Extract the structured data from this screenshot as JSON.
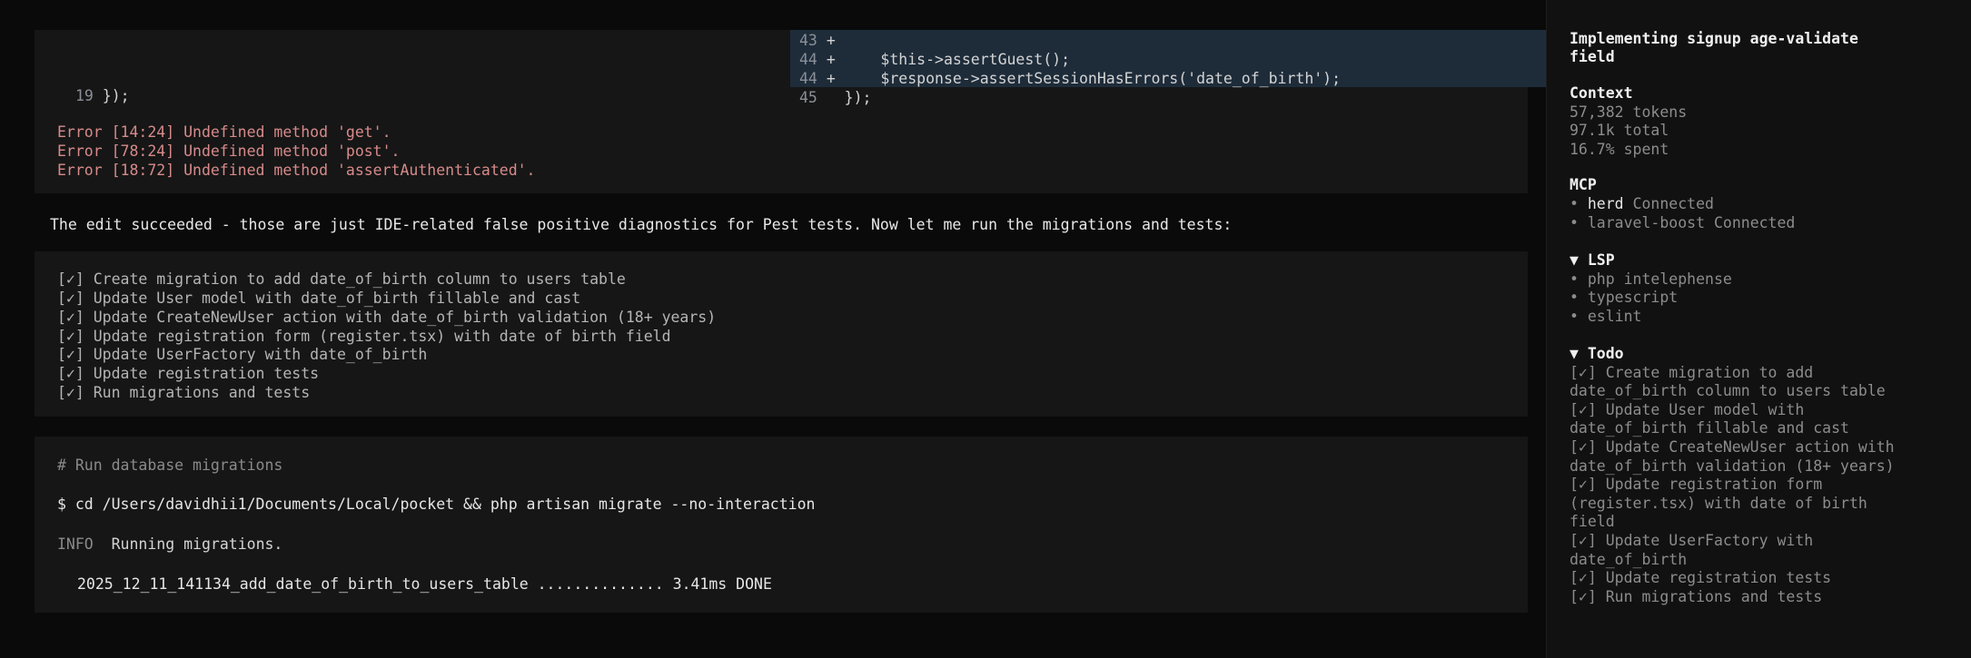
{
  "diff": {
    "lines": [
      {
        "num": "43",
        "mark": "+",
        "code": ""
      },
      {
        "num": "44",
        "mark": "+",
        "code": "    $this->assertGuest();"
      },
      {
        "num": "44",
        "mark": "+",
        "code": "    $response->assertSessionHasErrors('date_of_birth');"
      },
      {
        "num": "45",
        "mark": "",
        "code": " });"
      }
    ]
  },
  "left_code": {
    "num": "19",
    "code": " });"
  },
  "errors": [
    "Error [14:24] Undefined method 'get'.",
    "Error [78:24] Undefined method 'post'.",
    "Error [18:72] Undefined method 'assertAuthenticated'."
  ],
  "message": "The edit succeeded - those are just IDE-related false positive diagnostics for Pest tests. Now let me run the migrations and tests:",
  "todos": [
    "[✓] Create migration to add date_of_birth column to users table",
    "[✓] Update User model with date_of_birth fillable and cast",
    "[✓] Update CreateNewUser action with date_of_birth validation (18+ years)",
    "[✓] Update registration form (register.tsx) with date of birth field",
    "[✓] Update UserFactory with date_of_birth",
    "[✓] Update registration tests",
    "[✓] Run migrations and tests"
  ],
  "terminal": {
    "comment": "# Run database migrations",
    "command": "$ cd /Users/davidhii1/Documents/Local/pocket && php artisan migrate --no-interaction",
    "info_tag": "INFO",
    "info_text": "Running migrations.",
    "result": "2025_12_11_141134_add_date_of_birth_to_users_table .............. 3.41ms DONE"
  },
  "sidebar": {
    "title_line1": "Implementing signup age-validate",
    "title_line2": "field",
    "context": {
      "heading": "Context",
      "tokens": "57,382 tokens",
      "total": "97.1k total",
      "spent": "16.7% spent"
    },
    "mcp": {
      "heading": "MCP",
      "servers": [
        {
          "name": "herd",
          "status": "Connected"
        },
        {
          "name": "laravel-boost",
          "status": "Connected"
        }
      ]
    },
    "lsp": {
      "heading": "▼ LSP",
      "items": [
        "• php intelephense",
        "• typescript",
        "• eslint"
      ]
    },
    "todo": {
      "heading": "▼ Todo",
      "lines": [
        "[✓] Create migration to add",
        "date_of_birth column to users table",
        "[✓] Update User model with",
        "date_of_birth fillable and cast",
        "[✓] Update CreateNewUser action with",
        "date_of_birth validation (18+ years)",
        "[✓] Update registration form",
        "(register.tsx) with date of birth",
        "field",
        "[✓] Update UserFactory with",
        "date_of_birth",
        "[✓] Update registration tests",
        "[✓] Run migrations and tests"
      ]
    }
  }
}
